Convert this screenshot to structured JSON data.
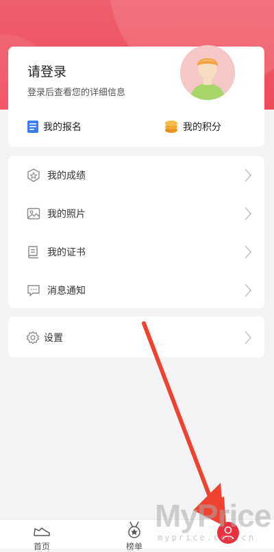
{
  "profile": {
    "title": "请登录",
    "subtitle": "登录后查看您的详细信息",
    "signup_label": "我的报名",
    "points_label": "我的积分"
  },
  "menu": {
    "items": [
      {
        "label": "我的成绩",
        "icon": "score-shield-icon"
      },
      {
        "label": "我的照片",
        "icon": "photo-icon"
      },
      {
        "label": "我的证书",
        "icon": "certificate-icon"
      },
      {
        "label": "消息通知",
        "icon": "message-icon"
      }
    ]
  },
  "settings": {
    "label": "设置",
    "icon": "gear-icon"
  },
  "tabbar": {
    "items": [
      {
        "label": "首页",
        "icon": "sneaker-icon"
      },
      {
        "label": "榜单",
        "icon": "medal-icon"
      },
      {
        "label": "",
        "icon": "user-icon"
      }
    ]
  },
  "watermark": {
    "main": "MyPrice",
    "sub": "myprice.com.cn"
  },
  "colors": {
    "header": "#ef4b5b",
    "accent": "#e9303e",
    "annotation_arrow": "#f0432f"
  }
}
